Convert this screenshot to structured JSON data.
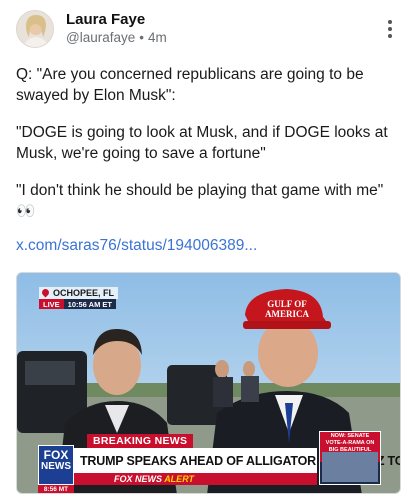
{
  "author": {
    "name": "Laura Faye",
    "handle": "@laurafaye",
    "separator": "•",
    "time": "4m"
  },
  "icons": {
    "avatar": "avatar",
    "more": "more-options-vertical-icon",
    "location": "location-pin-icon"
  },
  "post": {
    "paragraph1": "Q: \"Are you concerned republicans are going to be swayed by Elon Musk\":",
    "paragraph2": "\"DOGE is going to look at Musk, and if DOGE looks at Musk, we're going to save a fortune\"",
    "paragraph3": "\"I don't think he should be playing that game with me\" 👀",
    "link": "x.com/saras76/status/194006389..."
  },
  "media": {
    "location": "OCHOPEE, FL",
    "live": "LIVE",
    "live_time": "10:56 AM ET",
    "breaking": "BREAKING NEWS",
    "headline": "TRUMP SPEAKS AHEAD OF ALLIGATOR ALCATRAZ TOUR",
    "alert_brand": "FOX NEWS",
    "alert_word": "ALERT",
    "logo_line1": "FOX",
    "logo_line2": "NEWS",
    "logo_time": "8:56 MT",
    "side_caption": "NOW: SENATE VOTE-A-RAMA ON BIG BEAUTIFUL BILL",
    "hat_text": "GULF OF AMERICA"
  },
  "colors": {
    "link": "#3b73d6",
    "fox_red": "#c8102e",
    "fox_blue": "#1c3f94",
    "hat_red": "#c4161c"
  }
}
